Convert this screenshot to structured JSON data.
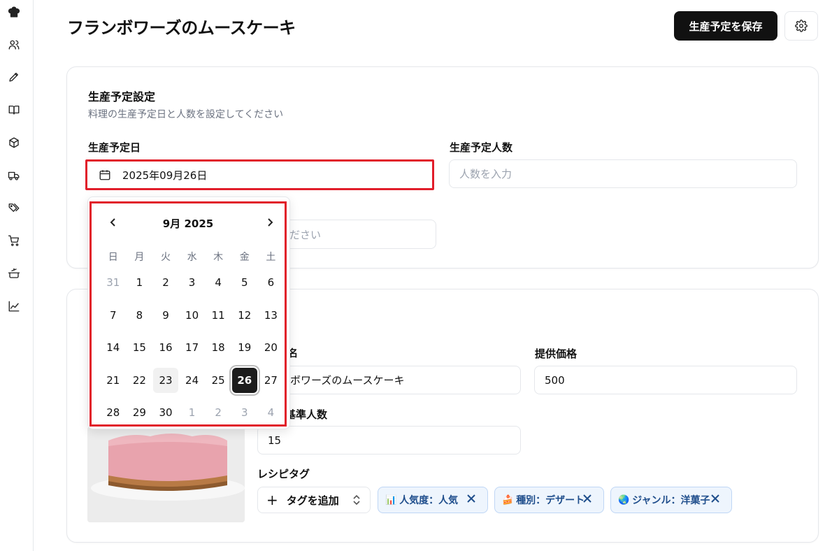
{
  "page": {
    "title": "フランボワーズのムースケーキ"
  },
  "header": {
    "save_label": "生産予定を保存"
  },
  "production": {
    "title": "生産予定設定",
    "subtitle": "料理の生産予定日と人数を設定してください",
    "date_label": "生産予定日",
    "date_value": "2025年09月26日",
    "people_label": "生産予定人数",
    "people_placeholder": "人数を入力",
    "hidden_input_visible_text": "ください"
  },
  "calendar": {
    "month_label": "9月 2025",
    "weekdays": [
      "日",
      "月",
      "火",
      "水",
      "木",
      "金",
      "土"
    ],
    "weeks": [
      [
        "31",
        "1",
        "2",
        "3",
        "4",
        "5",
        "6"
      ],
      [
        "7",
        "8",
        "9",
        "10",
        "11",
        "12",
        "13"
      ],
      [
        "14",
        "15",
        "16",
        "17",
        "18",
        "19",
        "20"
      ],
      [
        "21",
        "22",
        "23",
        "24",
        "25",
        "26",
        "27"
      ],
      [
        "28",
        "29",
        "30",
        "1",
        "2",
        "3",
        "4"
      ]
    ],
    "today": "23",
    "selected": "26"
  },
  "recipe": {
    "name_label_partial": "名",
    "name_value_partial": "ボワーズのムースケーキ",
    "price_label": "提供価格",
    "price_value": "500",
    "base_people_label_partial": "基準人数",
    "base_people_value": "15",
    "tag_label": "レシピタグ",
    "add_tag_label": "タグを追加",
    "tags": [
      {
        "icon": "📊",
        "label": "人気度：人気"
      },
      {
        "icon": "🍰",
        "label": "種別：デザート"
      },
      {
        "icon": "🌏",
        "label": "ジャンル：洋菓子"
      }
    ]
  },
  "sidebar": {
    "icons": [
      "chef-hat-icon",
      "users-icon",
      "pen-icon",
      "book-icon",
      "box-icon",
      "truck-icon",
      "tags-icon",
      "cart-icon",
      "pot-icon",
      "chart-icon"
    ]
  }
}
